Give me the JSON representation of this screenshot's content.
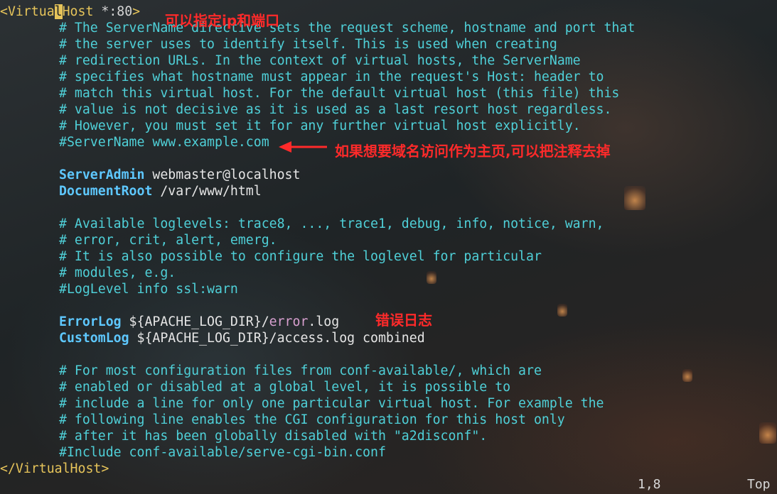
{
  "editor": {
    "lines": {
      "l1": {
        "tag_open": "<Virtua",
        "cursor_char": "l",
        "tag_rest": "Host",
        "attr": " *:80",
        "tag_close": ">"
      },
      "l2": "# The ServerName directive sets the request scheme, hostname and port that",
      "l3": "# the server uses to identify itself. This is used when creating",
      "l4": "# redirection URLs. In the context of virtual hosts, the ServerName",
      "l5": "# specifies what hostname must appear in the request's Host: header to",
      "l6": "# match this virtual host. For the default virtual host (this file) this",
      "l7": "# value is not decisive as it is used as a last resort host regardless.",
      "l8": "# However, you must set it for any further virtual host explicitly.",
      "l9": "#ServerName www.example.com",
      "l11": {
        "directive": "ServerAdmin",
        "value": " webmaster@localhost"
      },
      "l12": {
        "directive": "DocumentRoot",
        "value": " /var/www/html"
      },
      "l14": "# Available loglevels: trace8, ..., trace1, debug, info, notice, warn,",
      "l15": "# error, crit, alert, emerg.",
      "l16": "# It is also possible to configure the loglevel for particular",
      "l17": "# modules, e.g.",
      "l18": "#LogLevel info ssl:warn",
      "l20": {
        "directive": "ErrorLog",
        "value_a": " ${APACHE_LOG_DIR}/",
        "value_b": "error",
        "value_c": ".log"
      },
      "l21": {
        "directive": "CustomLog",
        "value": " ${APACHE_LOG_DIR}/access.log combined"
      },
      "l23": "# For most configuration files from conf-available/, which are",
      "l24": "# enabled or disabled at a global level, it is possible to",
      "l25": "# include a line for only one particular virtual host. For example the",
      "l26": "# following line enables the CGI configuration for this host only",
      "l27": "# after it has been globally disabled with \"a2disconf\".",
      "l28": "#Include conf-available/serve-cgi-bin.conf",
      "l29": "</VirtualHost>"
    }
  },
  "annotations": {
    "ip_port": "可以指定ip和端口",
    "servername_hint": "如果想要域名访问作为主页,可以把注释去掉",
    "error_log": "错误日志",
    "arrow_color": "#ff2a2a"
  },
  "statusbar": {
    "position": "1,8",
    "scroll": "Top"
  },
  "colors": {
    "comment": "#4fd0d8",
    "directive": "#5ec8ff",
    "tag": "#e6c45a",
    "annotation": "#ff2a2a"
  }
}
